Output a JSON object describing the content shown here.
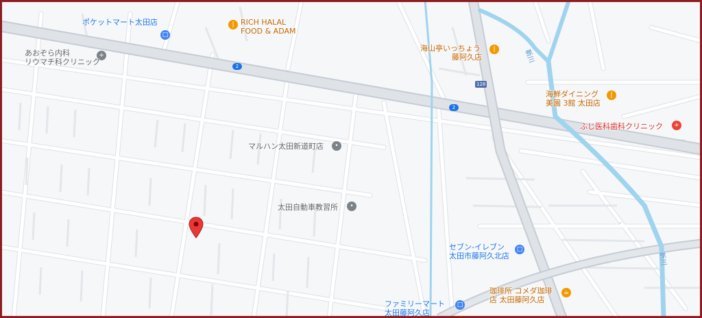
{
  "map": {
    "pois": [
      {
        "id": "pocket-mart",
        "label_lines": [
          "ポケットマート太田店"
        ],
        "category": "shop",
        "icon": "shopping-bag-icon"
      },
      {
        "id": "rich-halal",
        "label_lines": [
          "RICH HALAL",
          "FOOD & ADAM"
        ],
        "category": "food",
        "icon": "restaurant-icon"
      },
      {
        "id": "aozora-clinic",
        "label_lines": [
          "あおぞら内科",
          "リウマチ科クリニック"
        ],
        "category": "gray",
        "icon": "medical-icon"
      },
      {
        "id": "kaizan",
        "label_lines": [
          "海山亭いっちょう",
          "藤阿久店"
        ],
        "category": "food",
        "icon": "restaurant-icon"
      },
      {
        "id": "kaisen-dining",
        "label_lines": [
          "海鮮ダイニング",
          "美園 3館 太田店"
        ],
        "category": "food",
        "icon": "restaurant-icon"
      },
      {
        "id": "fuji-dental",
        "label_lines": [
          "ふじ医科歯科クリニック"
        ],
        "category": "health",
        "icon": "medical-icon"
      },
      {
        "id": "maruhan",
        "label_lines": [
          "マルハン太田新道町店"
        ],
        "category": "gray",
        "icon": "pin-icon"
      },
      {
        "id": "driving-school",
        "label_lines": [
          "太田自動車教習所"
        ],
        "category": "gray",
        "icon": "pin-icon"
      },
      {
        "id": "seven-eleven",
        "label_lines": [
          "セブン-イレブン",
          "太田市藤阿久北店"
        ],
        "category": "shop",
        "icon": "shopping-bag-icon"
      },
      {
        "id": "komeda",
        "label_lines": [
          "珈琲所 コメダ珈琲",
          "店 太田藤阿久店"
        ],
        "category": "food",
        "icon": "cafe-icon"
      },
      {
        "id": "family-mart",
        "label_lines": [
          "ファミリーマート",
          "太田藤阿久店"
        ],
        "category": "shop",
        "icon": "shopping-bag-icon"
      }
    ],
    "route_shields": [
      {
        "id": "shield-a",
        "text": "2"
      },
      {
        "id": "shield-b",
        "text": "2"
      },
      {
        "id": "shield-c",
        "text": "128"
      }
    ],
    "river_labels": [
      "新川",
      "新川"
    ],
    "selected_marker": {
      "icon": "location-pin-icon",
      "color": "#e53935"
    },
    "colors": {
      "background": "#f6f7f9",
      "road": "#ffffff",
      "road_outline": "#d8dce1",
      "major_road": "#cfd6de",
      "river": "#9fd3ee",
      "frame": "#8e1d22"
    }
  }
}
